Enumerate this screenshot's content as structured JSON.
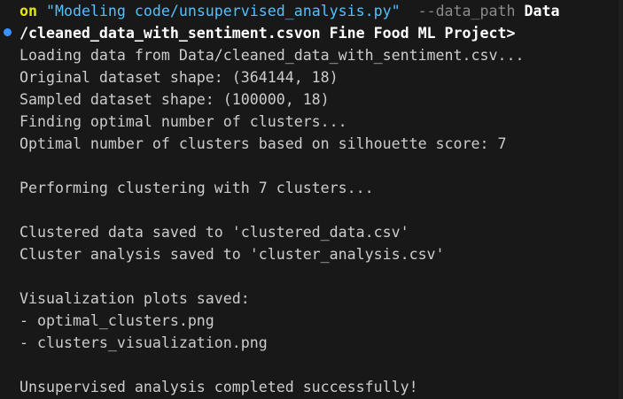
{
  "command": {
    "prefix": "on ",
    "script": "\"Modeling code/unsupervised_analysis.py\"",
    "flag": "  --data_path ",
    "path_start": "Data",
    "line2": "/cleaned_data_with_sentiment.csvon Fine Food ML Project>"
  },
  "output": [
    "Loading data from Data/cleaned_data_with_sentiment.csv...",
    "Original dataset shape: (364144, 18)",
    "Sampled dataset shape: (100000, 18)",
    "Finding optimal number of clusters...",
    "Optimal number of clusters based on silhouette score: 7",
    "",
    "Performing clustering with 7 clusters...",
    "",
    "Clustered data saved to 'clustered_data.csv'",
    "Cluster analysis saved to 'cluster_analysis.csv'",
    "",
    "Visualization plots saved:",
    "- optimal_clusters.png",
    "- clusters_visualization.png",
    "",
    "Unsupervised analysis completed successfully!"
  ],
  "colors": {
    "background": "#181818",
    "text": "#cccccc",
    "keyword": "#e5e510",
    "string": "#4fc1ff",
    "flag": "#8a8a8a",
    "decoration_dot": "#3794ff"
  }
}
